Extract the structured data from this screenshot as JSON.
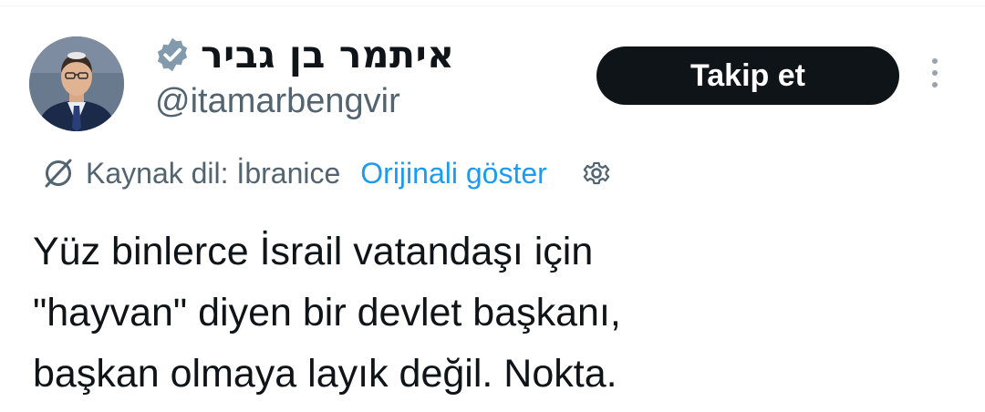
{
  "author": {
    "display_name": "איתמר בן גביר",
    "handle": "@itamarbengvir",
    "verified": true
  },
  "follow_button": {
    "label": "Takip et"
  },
  "translation": {
    "source_label": "Kaynak dil: İbranice",
    "show_original": "Orijinali göster"
  },
  "tweet": {
    "lines": [
      "Yüz binlerce İsrail vatandaşı için",
      "\"hayvan\" diyen bir devlet başkanı,",
      "başkan olmaya layık değil. Nokta."
    ]
  },
  "colors": {
    "text_primary": "#0f1419",
    "text_secondary": "#536471",
    "link": "#1d9bf0",
    "button_bg": "#0f1419",
    "button_text": "#ffffff",
    "verified_badge": "#829aab"
  },
  "icons": {
    "verified": "verified-badge-icon",
    "more": "more-vertical-icon",
    "translate": "translate-icon",
    "settings": "gear-icon"
  }
}
